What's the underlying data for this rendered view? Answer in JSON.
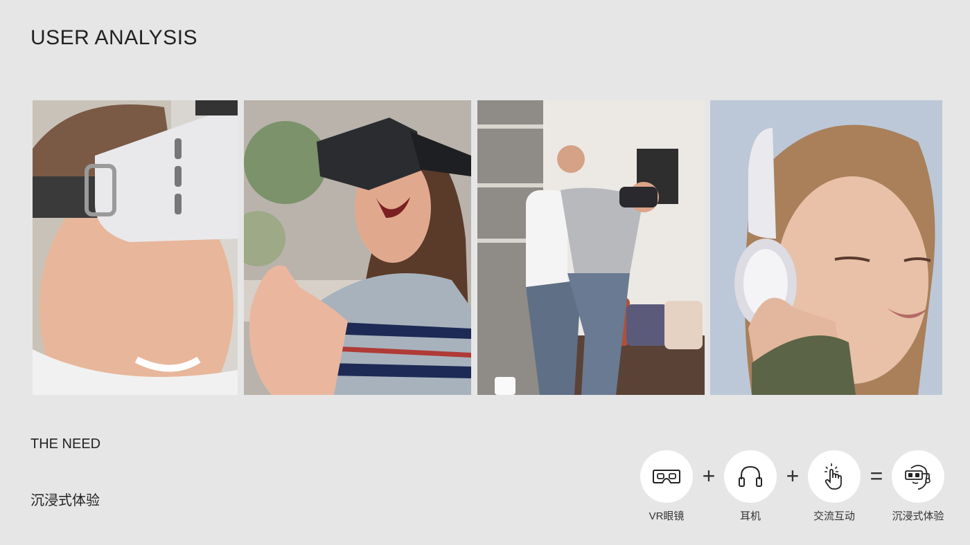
{
  "header": {
    "title": "USER ANALYSIS"
  },
  "photos": [
    {
      "icon": "vr-headset-man-photo"
    },
    {
      "icon": "vr-headset-woman-photo"
    },
    {
      "icon": "vr-couple-living-room-photo"
    },
    {
      "icon": "headphones-woman-photo"
    }
  ],
  "need": {
    "title": "THE NEED",
    "text": "沉浸式体验"
  },
  "formula": {
    "items": [
      {
        "label": "VR眼镜",
        "icon": "vr-glasses-icon"
      },
      {
        "label": "耳机",
        "icon": "headphones-icon"
      },
      {
        "label": "交流互动",
        "icon": "tap-gesture-icon"
      },
      {
        "label": "沉浸式体验",
        "icon": "immersive-user-icon"
      }
    ],
    "operators": [
      "+",
      "+",
      "="
    ]
  },
  "colors": {
    "background": "#e6e6e6",
    "circle": "#ffffff",
    "text": "#222222"
  }
}
